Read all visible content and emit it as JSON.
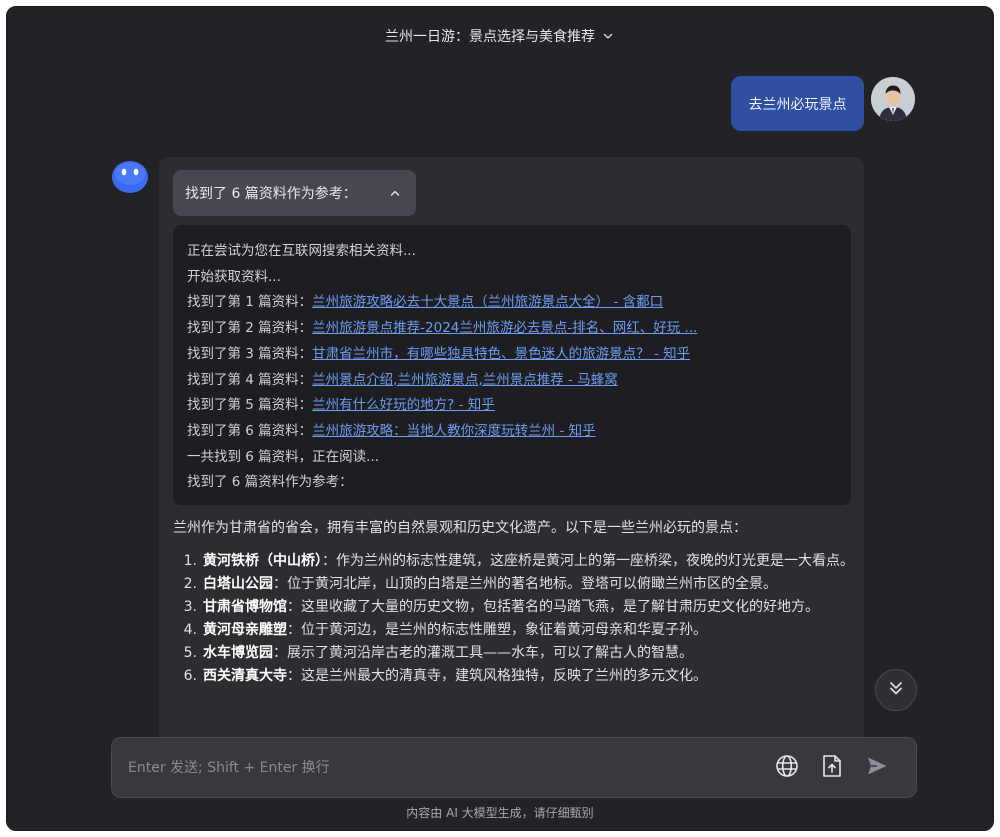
{
  "header": {
    "title": "兰州一日游：景点选择与美食推荐"
  },
  "user_message": {
    "text": "去兰州必玩景点"
  },
  "bot_message": {
    "refs_toggle_label": "找到了 6 篇资料作为参考：",
    "refs_log": {
      "searching": "正在尝试为您在互联网搜索相关资料...",
      "start": "开始获取资料...",
      "items": [
        {
          "prefix": "找到了第 1 篇资料：",
          "link": "兰州旅游攻略必去十大景点（兰州旅游景点大全） - 含鄱口"
        },
        {
          "prefix": "找到了第 2 篇资料：",
          "link": "兰州旅游景点推荐-2024兰州旅游必去景点-排名、网红、好玩 ..."
        },
        {
          "prefix": "找到了第 3 篇资料：",
          "link": "甘肃省兰州市，有哪些独具特色、景色迷人的旅游景点？ - 知乎"
        },
        {
          "prefix": "找到了第 4 篇资料：",
          "link": "兰州景点介绍,兰州旅游景点,兰州景点推荐 - 马蜂窝"
        },
        {
          "prefix": "找到了第 5 篇资料：",
          "link": "兰州有什么好玩的地方? - 知乎"
        },
        {
          "prefix": "找到了第 6 篇资料：",
          "link": "兰州旅游攻略：当地人教你深度玩转兰州 - 知乎"
        }
      ],
      "reading": "一共找到 6 篇资料，正在阅读...",
      "done": "找到了 6 篇资料作为参考："
    },
    "answer_intro": "兰州作为甘肃省的省会，拥有丰富的自然景观和历史文化遗产。以下是一些兰州必玩的景点：",
    "answer_items": [
      {
        "num": "1.",
        "title": "黄河铁桥（中山桥）",
        "text": "：作为兰州的标志性建筑，这座桥是黄河上的第一座桥梁，夜晚的灯光更是一大看点。"
      },
      {
        "num": "2.",
        "title": "白塔山公园",
        "text": "：位于黄河北岸，山顶的白塔是兰州的著名地标。登塔可以俯瞰兰州市区的全景。"
      },
      {
        "num": "3.",
        "title": "甘肃省博物馆",
        "text": "：这里收藏了大量的历史文物，包括著名的马踏飞燕，是了解甘肃历史文化的好地方。"
      },
      {
        "num": "4.",
        "title": "黄河母亲雕塑",
        "text": "：位于黄河边，是兰州的标志性雕塑，象征着黄河母亲和华夏子孙。"
      },
      {
        "num": "5.",
        "title": "水车博览园",
        "text": "：展示了黄河沿岸古老的灌溉工具——水车，可以了解古人的智慧。"
      },
      {
        "num": "6.",
        "title": "西关清真大寺",
        "text": "：这是兰州最大的清真寺，建筑风格独特，反映了兰州的多元文化。"
      }
    ]
  },
  "composer": {
    "placeholder": "Enter 发送; Shift + Enter 换行"
  },
  "footer": {
    "disclaimer": "内容由 AI 大模型生成，请仔细甄别"
  },
  "icons": {
    "header_dropdown": "chevron-down-icon",
    "refs_collapse": "chevron-up-icon",
    "scroll_down": "double-chevron-down-icon",
    "web_search": "globe-icon",
    "upload": "upload-file-icon",
    "send": "send-icon"
  },
  "colors": {
    "background": "#232327",
    "user_bubble": "#2f4fa2",
    "link": "#6d9cf0",
    "bot_avatar": "#3b6cf0"
  }
}
